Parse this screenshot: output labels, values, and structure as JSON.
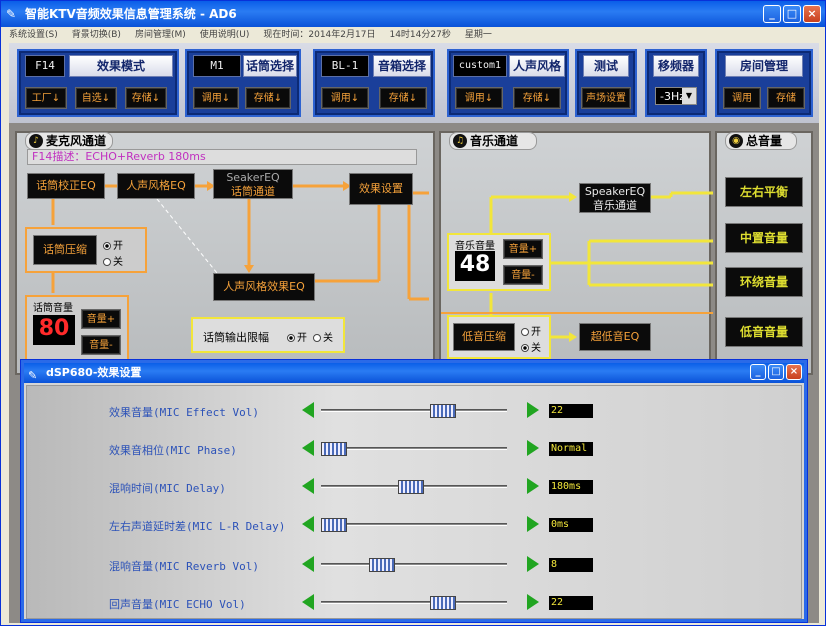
{
  "window": {
    "title": "智能KTV音频效果信息管理系统 - AD6",
    "btn_min": "_",
    "btn_max": "□",
    "btn_close": "×"
  },
  "menu": {
    "items": [
      "系统设置(S)",
      "背景切换(B)",
      "房间管理(M)",
      "使用说明(U)",
      "现在时间：2014年2月17日",
      "14时14分27秒",
      "星期一"
    ]
  },
  "toolbar": {
    "effect": {
      "lcd": "F14",
      "title": "效果模式",
      "b1": "工厂↓",
      "b2": "自选↓",
      "b3": "存储↓"
    },
    "mic": {
      "lcd": "M1",
      "title": "话筒选择",
      "b1": "调用↓",
      "b2": "存储↓"
    },
    "speaker": {
      "lcd": "BL-1",
      "title": "音箱选择",
      "b1": "调用↓",
      "b2": "存储↓"
    },
    "voice": {
      "lcd": "custom1",
      "title": "人声风格",
      "b1": "调用↓",
      "b2": "存储↓"
    },
    "test": {
      "title": "测试",
      "b1": "声场设置"
    },
    "shift": {
      "title": "移频器",
      "value": "-3Hz",
      "dd": "▼"
    },
    "room": {
      "title": "房间管理",
      "b1": "调用",
      "b2": "存储"
    }
  },
  "mic_panel": {
    "title": "麦克风通道",
    "desc": "F14描述：ECHO+Reverb 180ms",
    "eq_correct": "话筒校正EQ",
    "voice_eq": "人声风格EQ",
    "seaker_eq_1": "SeakerEQ",
    "seaker_eq_2": "话筒通道",
    "effect_set": "效果设置",
    "compress": "话筒压缩",
    "on": "开",
    "off": "关",
    "voice_effect_eq": "人声风格效果EQ",
    "vol_label": "话筒音量",
    "vol_value": "80",
    "vol_up": "音量+",
    "vol_down": "音量-",
    "limit_label": "话筒输出限幅",
    "limit_on": "开",
    "limit_off": "关"
  },
  "music_panel": {
    "title": "音乐通道",
    "speaker_eq_1": "SpeakerEQ",
    "speaker_eq_2": "音乐通道",
    "vol_label": "音乐音量",
    "vol_value": "48",
    "vol_up": "音量+",
    "vol_down": "音量-",
    "bass_compress": "低音压缩",
    "on": "开",
    "off": "关",
    "sub_eq": "超低音EQ"
  },
  "master_panel": {
    "title": "总音量",
    "balance": "左右平衡",
    "center": "中置音量",
    "surround": "环绕音量",
    "bass": "低音音量"
  },
  "dialog": {
    "title": "dSP680-效果设置",
    "rows": [
      {
        "label": "效果音量(MIC Effect Vol)",
        "value": "22",
        "pos": 0.68
      },
      {
        "label": "效果音相位(MIC Phase)",
        "value": "Normal",
        "pos": 0.0
      },
      {
        "label": "混响时间(MIC Delay)",
        "value": "180ms",
        "pos": 0.48
      },
      {
        "label": "左右声道延时差(MIC L-R Delay)",
        "value": "0ms",
        "pos": 0.0
      },
      {
        "label": "混响音量(MIC Reverb Vol)",
        "value": "8",
        "pos": 0.3
      },
      {
        "label": "回声音量(MIC ECHO Vol)",
        "value": "22",
        "pos": 0.68
      }
    ]
  }
}
